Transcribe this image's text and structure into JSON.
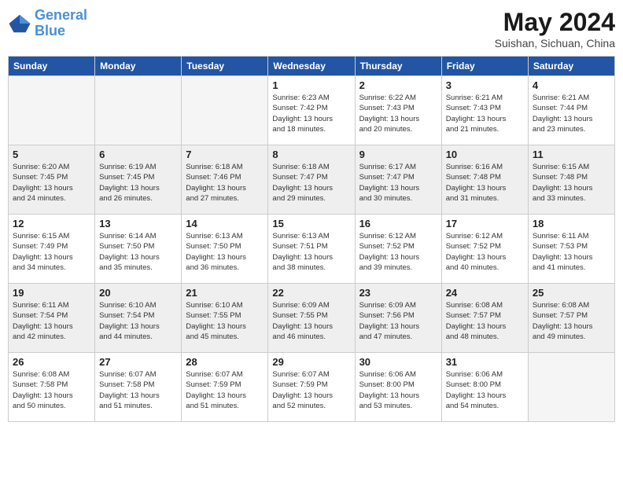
{
  "header": {
    "logo_line1": "General",
    "logo_line2": "Blue",
    "month_title": "May 2024",
    "location": "Suishan, Sichuan, China"
  },
  "weekdays": [
    "Sunday",
    "Monday",
    "Tuesday",
    "Wednesday",
    "Thursday",
    "Friday",
    "Saturday"
  ],
  "weeks": [
    [
      {
        "day": "",
        "info": ""
      },
      {
        "day": "",
        "info": ""
      },
      {
        "day": "",
        "info": ""
      },
      {
        "day": "1",
        "info": "Sunrise: 6:23 AM\nSunset: 7:42 PM\nDaylight: 13 hours\nand 18 minutes."
      },
      {
        "day": "2",
        "info": "Sunrise: 6:22 AM\nSunset: 7:43 PM\nDaylight: 13 hours\nand 20 minutes."
      },
      {
        "day": "3",
        "info": "Sunrise: 6:21 AM\nSunset: 7:43 PM\nDaylight: 13 hours\nand 21 minutes."
      },
      {
        "day": "4",
        "info": "Sunrise: 6:21 AM\nSunset: 7:44 PM\nDaylight: 13 hours\nand 23 minutes."
      }
    ],
    [
      {
        "day": "5",
        "info": "Sunrise: 6:20 AM\nSunset: 7:45 PM\nDaylight: 13 hours\nand 24 minutes."
      },
      {
        "day": "6",
        "info": "Sunrise: 6:19 AM\nSunset: 7:45 PM\nDaylight: 13 hours\nand 26 minutes."
      },
      {
        "day": "7",
        "info": "Sunrise: 6:18 AM\nSunset: 7:46 PM\nDaylight: 13 hours\nand 27 minutes."
      },
      {
        "day": "8",
        "info": "Sunrise: 6:18 AM\nSunset: 7:47 PM\nDaylight: 13 hours\nand 29 minutes."
      },
      {
        "day": "9",
        "info": "Sunrise: 6:17 AM\nSunset: 7:47 PM\nDaylight: 13 hours\nand 30 minutes."
      },
      {
        "day": "10",
        "info": "Sunrise: 6:16 AM\nSunset: 7:48 PM\nDaylight: 13 hours\nand 31 minutes."
      },
      {
        "day": "11",
        "info": "Sunrise: 6:15 AM\nSunset: 7:48 PM\nDaylight: 13 hours\nand 33 minutes."
      }
    ],
    [
      {
        "day": "12",
        "info": "Sunrise: 6:15 AM\nSunset: 7:49 PM\nDaylight: 13 hours\nand 34 minutes."
      },
      {
        "day": "13",
        "info": "Sunrise: 6:14 AM\nSunset: 7:50 PM\nDaylight: 13 hours\nand 35 minutes."
      },
      {
        "day": "14",
        "info": "Sunrise: 6:13 AM\nSunset: 7:50 PM\nDaylight: 13 hours\nand 36 minutes."
      },
      {
        "day": "15",
        "info": "Sunrise: 6:13 AM\nSunset: 7:51 PM\nDaylight: 13 hours\nand 38 minutes."
      },
      {
        "day": "16",
        "info": "Sunrise: 6:12 AM\nSunset: 7:52 PM\nDaylight: 13 hours\nand 39 minutes."
      },
      {
        "day": "17",
        "info": "Sunrise: 6:12 AM\nSunset: 7:52 PM\nDaylight: 13 hours\nand 40 minutes."
      },
      {
        "day": "18",
        "info": "Sunrise: 6:11 AM\nSunset: 7:53 PM\nDaylight: 13 hours\nand 41 minutes."
      }
    ],
    [
      {
        "day": "19",
        "info": "Sunrise: 6:11 AM\nSunset: 7:54 PM\nDaylight: 13 hours\nand 42 minutes."
      },
      {
        "day": "20",
        "info": "Sunrise: 6:10 AM\nSunset: 7:54 PM\nDaylight: 13 hours\nand 44 minutes."
      },
      {
        "day": "21",
        "info": "Sunrise: 6:10 AM\nSunset: 7:55 PM\nDaylight: 13 hours\nand 45 minutes."
      },
      {
        "day": "22",
        "info": "Sunrise: 6:09 AM\nSunset: 7:55 PM\nDaylight: 13 hours\nand 46 minutes."
      },
      {
        "day": "23",
        "info": "Sunrise: 6:09 AM\nSunset: 7:56 PM\nDaylight: 13 hours\nand 47 minutes."
      },
      {
        "day": "24",
        "info": "Sunrise: 6:08 AM\nSunset: 7:57 PM\nDaylight: 13 hours\nand 48 minutes."
      },
      {
        "day": "25",
        "info": "Sunrise: 6:08 AM\nSunset: 7:57 PM\nDaylight: 13 hours\nand 49 minutes."
      }
    ],
    [
      {
        "day": "26",
        "info": "Sunrise: 6:08 AM\nSunset: 7:58 PM\nDaylight: 13 hours\nand 50 minutes."
      },
      {
        "day": "27",
        "info": "Sunrise: 6:07 AM\nSunset: 7:58 PM\nDaylight: 13 hours\nand 51 minutes."
      },
      {
        "day": "28",
        "info": "Sunrise: 6:07 AM\nSunset: 7:59 PM\nDaylight: 13 hours\nand 51 minutes."
      },
      {
        "day": "29",
        "info": "Sunrise: 6:07 AM\nSunset: 7:59 PM\nDaylight: 13 hours\nand 52 minutes."
      },
      {
        "day": "30",
        "info": "Sunrise: 6:06 AM\nSunset: 8:00 PM\nDaylight: 13 hours\nand 53 minutes."
      },
      {
        "day": "31",
        "info": "Sunrise: 6:06 AM\nSunset: 8:00 PM\nDaylight: 13 hours\nand 54 minutes."
      },
      {
        "day": "",
        "info": ""
      }
    ]
  ]
}
